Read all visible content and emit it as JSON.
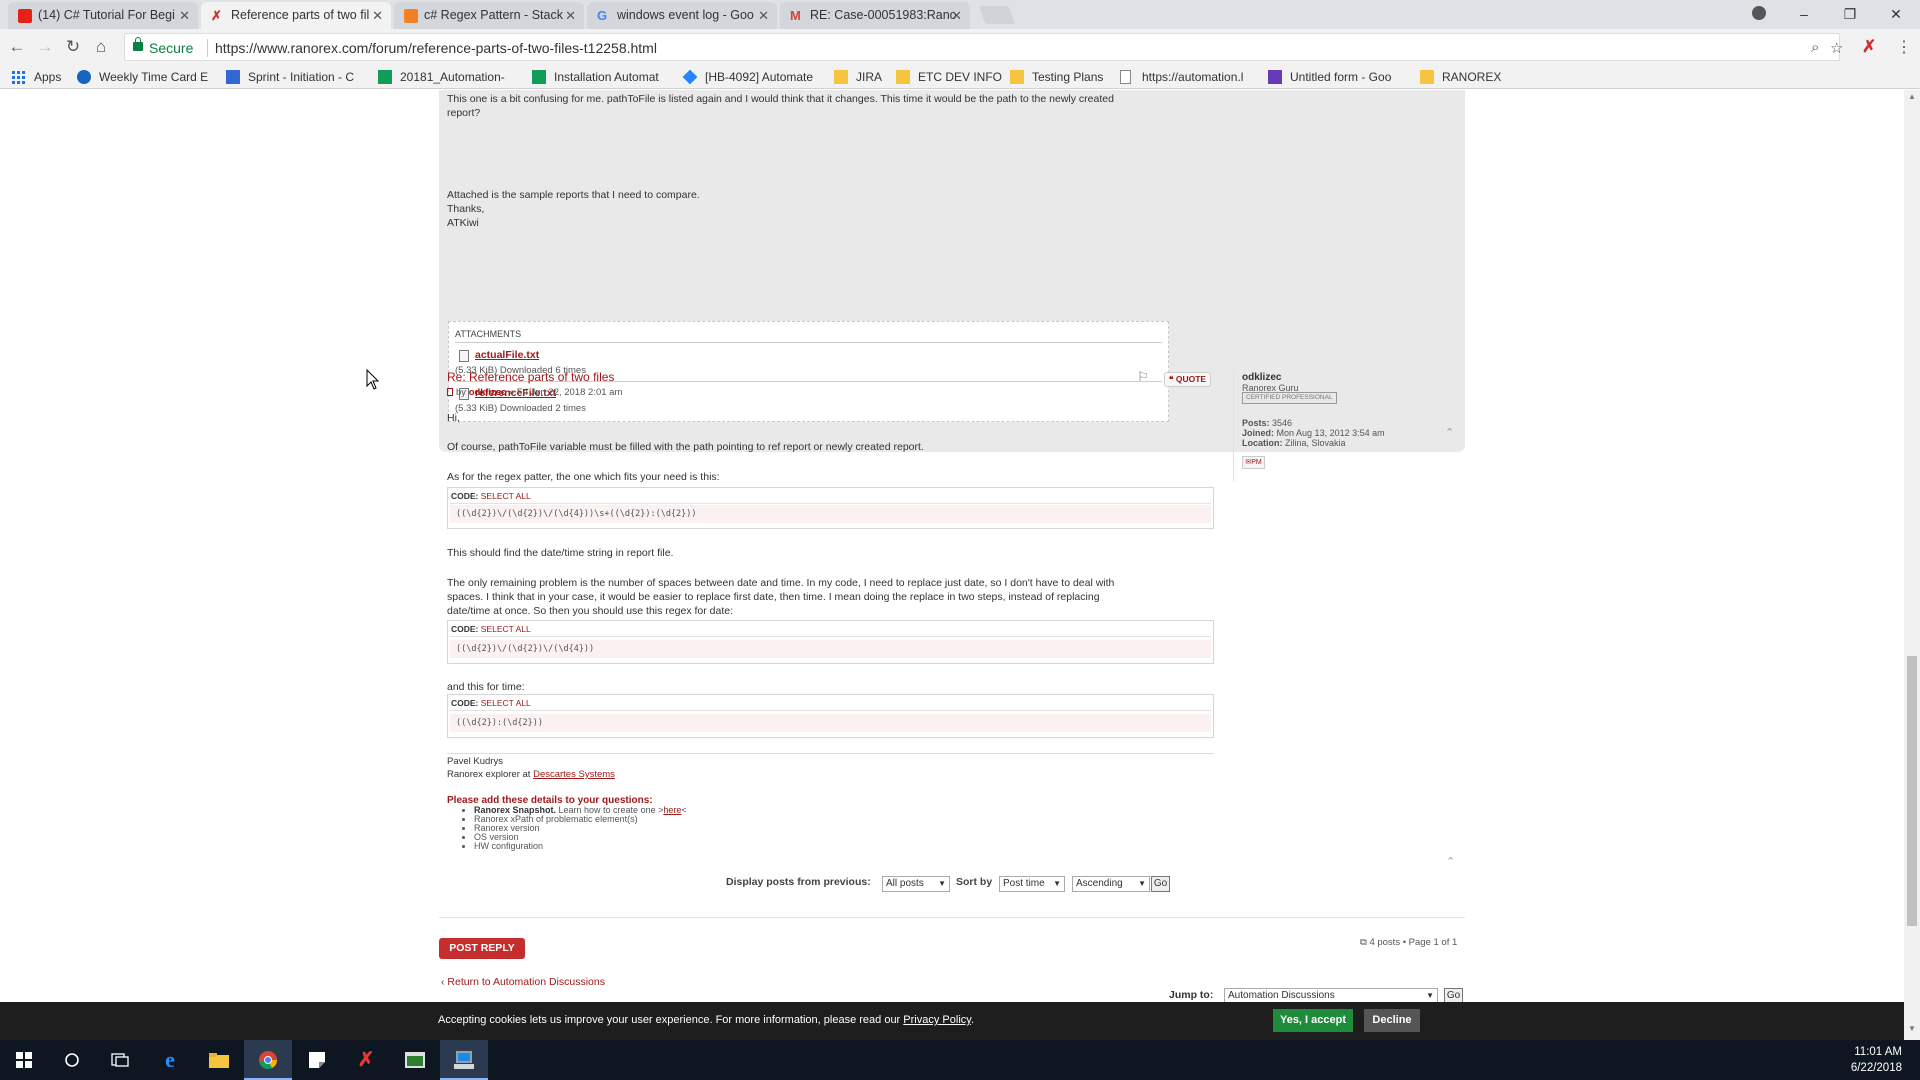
{
  "browser": {
    "tabs": [
      {
        "label": "(14) C# Tutorial For Begi",
        "favicon_color": "#e62117",
        "icon": "youtube-icon"
      },
      {
        "label": "Reference parts of two fil",
        "favicon_color": "#d32f2f",
        "icon": "ranorex-icon"
      },
      {
        "label": "c# Regex Pattern - Stack",
        "favicon_color": "#f48024",
        "icon": "stackoverflow-icon"
      },
      {
        "label": "windows event log - Goo",
        "favicon_color": "#4285f4",
        "icon": "google-icon"
      },
      {
        "label": "RE: Case-00051983:Rano",
        "favicon_color": "#d44638",
        "icon": "gmail-icon"
      }
    ],
    "secure_label": "Secure",
    "url": "https://www.ranorex.com/forum/reference-parts-of-two-files-t12258.html",
    "bookmarks": [
      {
        "label": "Apps",
        "color": "#1a73e8"
      },
      {
        "label": "Weekly Time Card E",
        "color": "#1565c0"
      },
      {
        "label": "Sprint - Initiation - C",
        "color": "#3367d6"
      },
      {
        "label": "20181_Automation-",
        "color": "#0f9d58"
      },
      {
        "label": "Installation Automat",
        "color": "#0f9d58"
      },
      {
        "label": "[HB-4092] Automate",
        "color": "#2684ff"
      },
      {
        "label": "JIRA",
        "color": "#f5c542"
      },
      {
        "label": "ETC DEV INFO",
        "color": "#f5c542"
      },
      {
        "label": "Testing Plans",
        "color": "#f5c542"
      },
      {
        "label": "https://automation.l",
        "color": "#888888"
      },
      {
        "label": "Untitled form - Goo",
        "color": "#673ab7"
      },
      {
        "label": "RANOREX",
        "color": "#f5c542"
      }
    ]
  },
  "post1": {
    "lines": [
      "This one is a bit confusing for me. pathToFile is listed again and I would think that it changes. This time it would be the path to the newly created",
      "report?"
    ],
    "closing": [
      "Attached is the sample reports that I need to compare.",
      "Thanks,",
      "ATKiwi"
    ],
    "attachments_heading": "ATTACHMENTS",
    "attachments": [
      {
        "name": "actualFile.txt",
        "meta": "(5.33 KiB) Downloaded 6 times"
      },
      {
        "name": "referenceFile.txt",
        "meta": "(5.33 KiB) Downloaded 2 times"
      }
    ]
  },
  "post2": {
    "title": "Re: Reference parts of two files",
    "by_prefix": "by",
    "author": "odklizec",
    "date": "» Fri Jun 22, 2018 2:01 am",
    "quote_label": "QUOTE",
    "greeting": "Hi,",
    "p1": "Of course, pathToFile variable must be filled with the path pointing to ref report or newly created report.",
    "p2": "As for the regex patter, the one which fits your need is this:",
    "code_label": "CODE:",
    "select_all": "SELECT ALL",
    "code1": "((\\d{2})\\/(\\d{2})\\/(\\d{4}))\\s+((\\d{2}):(\\d{2}))",
    "p3": "This should find the date/time string in report file.",
    "p4_lines": [
      "The only remaining problem is the number of spaces between date and time. In my code, I need to replace just date, so I don't have to deal with",
      "spaces. I think that in your case, it would be easier to replace first date, then time. I mean doing the replace in two steps, instead of replacing",
      "date/time at once. So then you should use this regex for date:"
    ],
    "code2": "((\\d{2})\\/(\\d{2})\\/(\\d{4}))",
    "p5": "and this for time:",
    "code3": "((\\d{2}):(\\d{2}))",
    "sig_name": "Pavel Kudrys",
    "sig_prefix": "Ranorex explorer at",
    "sig_company": "Descartes Systems",
    "req_title": "Please add these details to your questions:",
    "req_items": [
      {
        "bold": "Ranorex Snapshot.",
        "text": " Learn how to create one >",
        "link": "here",
        "suffix": "<"
      },
      {
        "bold": "",
        "text": "Ranorex xPath of problematic element(s)",
        "link": "",
        "suffix": ""
      },
      {
        "bold": "",
        "text": "Ranorex version",
        "link": "",
        "suffix": ""
      },
      {
        "bold": "",
        "text": "OS version",
        "link": "",
        "suffix": ""
      },
      {
        "bold": "",
        "text": "HW configuration",
        "link": "",
        "suffix": ""
      }
    ]
  },
  "profile": {
    "name": "odklizec",
    "rank": "Ranorex Guru",
    "badge": "CERTIFIED PROFESSIONAL",
    "posts_label": "Posts:",
    "posts": "3546",
    "joined_label": "Joined:",
    "joined": "Mon Aug 13, 2012 3:54 am",
    "location_label": "Location:",
    "location": "Zilina, Slovakia",
    "pm_label": "PM"
  },
  "sorting": {
    "display_label": "Display posts from previous:",
    "display_value": "All posts",
    "sort_label": "Sort by",
    "sort_value": "Post time",
    "order_value": "Ascending",
    "go_label": "Go"
  },
  "footer": {
    "post_reply": "POST REPLY",
    "pagination": "4 posts • Page 1 of 1",
    "return_link": "‹ Return to Automation Discussions",
    "jump_label": "Jump to:",
    "jump_value": "Automation Discussions",
    "jump_go": "Go"
  },
  "cookie": {
    "text": "Accepting cookies lets us improve your user experience. For more information, please read our",
    "policy_link": "Privacy Policy",
    "period": ".",
    "accept": "Yes, I accept",
    "decline": "Decline"
  },
  "taskbar": {
    "time": "11:01 AM",
    "date": "6/22/2018"
  }
}
